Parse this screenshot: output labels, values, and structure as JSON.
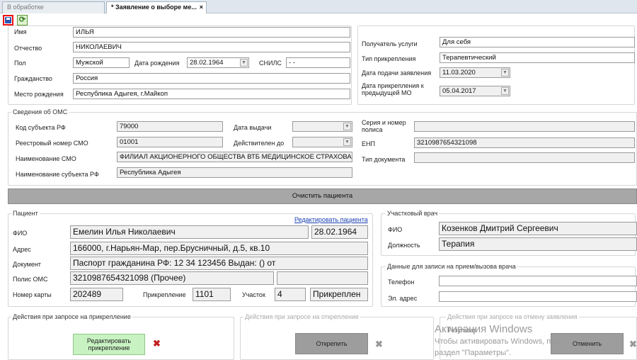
{
  "tabs": [
    {
      "label": "В обработке"
    },
    {
      "label": "* Заявление о выборе ме..."
    }
  ],
  "tab_close": "×",
  "toolbar": {
    "save_icon": "save-icon",
    "refresh_icon": "refresh-icon"
  },
  "person": {
    "name_label": "Имя",
    "name": "ИЛЬЯ",
    "patronymic_label": "Отчество",
    "patronymic": "НИКОЛАЕВИЧ",
    "sex_label": "Пол",
    "sex": "Мужской",
    "birth_label": "Дата рождения",
    "birth_date": "28.02.1964",
    "snils_label": "СНИЛС",
    "snils": "-  -",
    "citizenship_label": "Гражданство",
    "citizenship": "Россия",
    "birthplace_label": "Место рождения",
    "birthplace": "Республика Адыгея, г.Майкоп"
  },
  "service": {
    "recipient_label": "Получатель услуги",
    "recipient": "Для себя",
    "attach_type_label": "Тип прикрепления",
    "attach_type": "Терапевтический",
    "apply_date_label": "Дата подачи заявления",
    "apply_date": "11.03.2020",
    "prev_mo_label": "Дата прикрепления к предыдущей МО",
    "prev_mo_date": "05.04.2017"
  },
  "oms": {
    "legend": "Сведения об ОМС",
    "subject_code_label": "Код субъекта РФ",
    "subject_code": "79000",
    "issue_date_label": "Дата выдачи",
    "registry_label": "Реестровый номер СМО",
    "registry": "01001",
    "valid_until_label": "Действителен до",
    "smo_name_label": "Наименование СМО",
    "smo_name": "ФИЛИАЛ АКЦИОНЕРНОГО ОБЩЕСТВА ВТБ МЕДИЦИНСКОЕ СТРАХОВАНИЕ",
    "subject_name_label": "Наименование субъекта РФ",
    "subject_name": "Республика Адыгея",
    "policy_series_label": "Серия и номер полиса",
    "enp_label": "ЕНП",
    "enp": "3210987654321098",
    "doc_type_label": "Тип документа"
  },
  "clear_button": "Очистить пациента",
  "patient": {
    "legend": "Пациент",
    "edit_link": "Редактировать пациента",
    "fio_label": "ФИО",
    "fio": "Емелин Илья Николаевич",
    "birth_date": "28.02.1964",
    "address_label": "Адрес",
    "address": "166000, г.Нарьян-Мар, пер.Брусничный, д.5, кв.10",
    "document_label": "Документ",
    "document": "Паспорт гражданина РФ: 12 34 123456 Выдан: () от",
    "policy_label": "Полис ОМС",
    "policy": "3210987654321098 (Прочее)",
    "card_label": "Номер карты",
    "card": "202489",
    "attach_label": "Прикрепление",
    "attach": "1101",
    "area_label": "Участок",
    "area": "4",
    "attach_status": "Прикреплен"
  },
  "doctor": {
    "legend": "Участковый врач",
    "fio_label": "ФИО",
    "fio": "Козенков Дмитрий Сергеевич",
    "position_label": "Должность",
    "position": "Терапия"
  },
  "appointment": {
    "legend": "Данные для записи на прием/вызова врача",
    "phone_label": "Телефон",
    "email_label": "Эл. адрес"
  },
  "actions": {
    "attach_legend": "Действия при запросе на прикрепление",
    "edit_attach_button": "Редактировать прикрепление",
    "detach_legend": "Действия при запросе на открепление",
    "detach_button": "Открепить",
    "cancel_legend": "Действия при запросе на отмену заявления",
    "result_label": "Результат",
    "cancel_button": "Отменить"
  },
  "watermark": {
    "line1": "Активация Windows",
    "line2": "Чтобы активировать Windows, перейдите в",
    "line3": "раздел \"Параметры\"."
  }
}
